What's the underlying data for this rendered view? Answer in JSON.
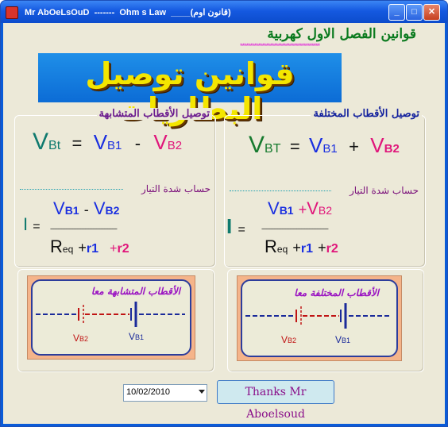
{
  "window": {
    "title": "Mr AbOeLsOuD  -------  Ohm s Law  ____(قانون اوم)",
    "minimize_glyph": "_",
    "maximize_glyph": "□",
    "close_glyph": "✕"
  },
  "header": {
    "arabic_title": "قوانين الفصل الاول كهربية",
    "stars": "****************************************",
    "banner": "قوانين توصيل البطاريات"
  },
  "left_panel": {
    "title": "توصيل الأقطاب المتشابهة",
    "formula_v": {
      "lhs": "V",
      "lhs_sub": "Bt",
      "eq": "=",
      "t1": "V",
      "t1_sub": "B1",
      "op": "-",
      "t2": "V",
      "t2_sub": "B2"
    },
    "current_title": "حساب شدة التيار",
    "formula_i": {
      "lhs": "I",
      "eq": "=",
      "n1": "V",
      "n1_sub": "B1",
      "op": "-",
      "n2": "V",
      "n2_sub": "B2",
      "dashes": "------------------------------------------",
      "d1": "R",
      "d1_sub": "eq",
      "p1": "+",
      "d2": "r1",
      "p2": "+",
      "d3": "r2"
    }
  },
  "right_panel": {
    "title": "توصيل الأقطاب المختلفة",
    "formula_v": {
      "lhs": "V",
      "lhs_sub": "BT",
      "eq": "=",
      "t1": "V",
      "t1_sub": "B1",
      "op": "+",
      "t2": "V",
      "t2_sub": "B2"
    },
    "current_title": "حساب شدة التيار",
    "formula_i": {
      "lhs": "I",
      "eq": "=",
      "n1": "V",
      "n1_sub": "B1",
      "op": "+",
      "n2": "V",
      "n2_sub": "B2",
      "dashes": "------------------------------------------",
      "d1": "R",
      "d1_sub": "eq",
      "p1": "+",
      "d2": "r1",
      "p2": "+",
      "d3": "r2"
    }
  },
  "pictures": {
    "left": {
      "caption": "الأقطاب المتشابهة معا",
      "v2": "V",
      "v2_sub": "B2",
      "v1": "V",
      "v1_sub": "B1"
    },
    "right": {
      "caption": "الأقطاب المختلفة معا",
      "v2": "V",
      "v2_sub": "B2",
      "v1": "V",
      "v1_sub": "B1"
    }
  },
  "footer": {
    "date_value": "10/02/2010",
    "thanks_label": "Thanks Mr Aboelsoud"
  },
  "colors": {
    "blue": "#1a2fe0",
    "pink": "#e0157a",
    "green": "#167a2e",
    "banner_bg": "#1f8fe8",
    "banner_text": "#f4e600"
  }
}
